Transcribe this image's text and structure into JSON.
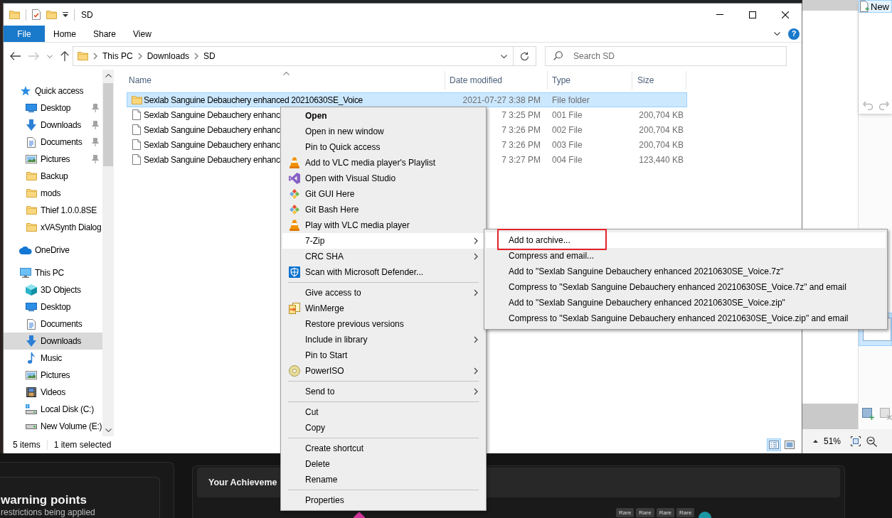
{
  "explorer": {
    "title": "SD",
    "ribbon": {
      "tabs": [
        {
          "label": "File",
          "kind": "menu"
        },
        {
          "label": "Home",
          "kind": "tab"
        },
        {
          "label": "Share",
          "kind": "tab"
        },
        {
          "label": "View",
          "kind": "tab"
        }
      ],
      "help": "?"
    },
    "history": {
      "back_disabled": false,
      "forward_disabled": true
    },
    "address": {
      "crumbs": [
        "This PC",
        "Downloads",
        "SD"
      ]
    },
    "search": {
      "placeholder": "Search SD"
    },
    "navigation": [
      {
        "label": "Quick access",
        "selected": false,
        "children": [
          {
            "label": "Desktop",
            "pinned": true,
            "selected": false
          },
          {
            "label": "Downloads",
            "pinned": true,
            "selected": false
          },
          {
            "label": "Documents",
            "pinned": true,
            "selected": false
          },
          {
            "label": "Pictures",
            "pinned": true,
            "selected": false
          },
          {
            "label": "Backup",
            "pinned": false,
            "selected": false
          },
          {
            "label": "mods",
            "pinned": false,
            "selected": false
          },
          {
            "label": "Thief 1.0.0.8SE",
            "pinned": false,
            "selected": false
          },
          {
            "label": "xVASynth Dialog",
            "pinned": false,
            "selected": false
          }
        ]
      },
      {
        "label": "OneDrive",
        "selected": false
      },
      {
        "label": "This PC",
        "selected": false,
        "children": [
          {
            "label": "3D Objects",
            "selected": false
          },
          {
            "label": "Desktop",
            "selected": false
          },
          {
            "label": "Documents",
            "selected": false
          },
          {
            "label": "Downloads",
            "selected": true
          },
          {
            "label": "Music",
            "selected": false
          },
          {
            "label": "Pictures",
            "selected": false
          },
          {
            "label": "Videos",
            "selected": false
          },
          {
            "label": "Local Disk (C:)",
            "selected": false
          },
          {
            "label": "New Volume (E:)",
            "selected": false
          }
        ]
      }
    ],
    "columns": [
      {
        "label": "Name",
        "sorted": true
      },
      {
        "label": "Date modified",
        "sorted": false
      },
      {
        "label": "Type",
        "sorted": false
      },
      {
        "label": "Size",
        "sorted": false
      }
    ],
    "files": [
      {
        "kind": "folder",
        "name": "Sexlab Sanguine Debauchery enhanced 20210630SE_Voice",
        "date": "2021-07-27 3:38 PM",
        "type": "File folder",
        "selected": true
      },
      {
        "kind": "file",
        "name": "Sexlab Sanguine Debauchery enhanc",
        "date": "7 3:25 PM",
        "type": "001 File",
        "size": "200,704 KB",
        "selected": false
      },
      {
        "kind": "file",
        "name": "Sexlab Sanguine Debauchery enhanc",
        "date": "7 3:26 PM",
        "type": "002 File",
        "size": "200,704 KB",
        "selected": false
      },
      {
        "kind": "file",
        "name": "Sexlab Sanguine Debauchery enhanc",
        "date": "7 3:26 PM",
        "type": "003 File",
        "size": "200,704 KB",
        "selected": false
      },
      {
        "kind": "file",
        "name": "Sexlab Sanguine Debauchery enhanc",
        "date": "7 3:27 PM",
        "type": "004 File",
        "size": "123,440 KB",
        "selected": false
      }
    ],
    "status": {
      "count": "5 items",
      "selection": "1 item selected"
    },
    "view_buttons": [
      {
        "selected": true
      },
      {
        "selected": false
      }
    ]
  },
  "context_menu": {
    "groups": [
      [
        {
          "label": "Open",
          "default": true,
          "submenu": false,
          "selected": false
        },
        {
          "label": "Open in new window",
          "default": false,
          "submenu": false,
          "selected": false
        },
        {
          "label": "Pin to Quick access",
          "default": false,
          "submenu": false,
          "selected": false
        },
        {
          "label": "Add to VLC media player's Playlist",
          "default": false,
          "submenu": false,
          "selected": false
        },
        {
          "label": "Open with Visual Studio",
          "default": false,
          "submenu": false,
          "selected": false
        },
        {
          "label": "Git GUI Here",
          "default": false,
          "submenu": false,
          "selected": false
        },
        {
          "label": "Git Bash Here",
          "default": false,
          "submenu": false,
          "selected": false
        },
        {
          "label": "Play with VLC media player",
          "default": false,
          "submenu": false,
          "selected": false
        },
        {
          "label": "7-Zip",
          "default": false,
          "submenu": true,
          "selected": true
        },
        {
          "label": "CRC SHA",
          "default": false,
          "submenu": true,
          "selected": false
        },
        {
          "label": "Scan with Microsoft Defender...",
          "default": false,
          "submenu": false,
          "selected": false
        }
      ],
      [
        {
          "label": "Give access to",
          "default": false,
          "submenu": true,
          "selected": false
        },
        {
          "label": "WinMerge",
          "default": false,
          "submenu": false,
          "selected": false
        },
        {
          "label": "Restore previous versions",
          "default": false,
          "submenu": false,
          "selected": false
        },
        {
          "label": "Include in library",
          "default": false,
          "submenu": true,
          "selected": false
        },
        {
          "label": "Pin to Start",
          "default": false,
          "submenu": false,
          "selected": false
        },
        {
          "label": "PowerISO",
          "default": false,
          "submenu": true,
          "selected": false
        }
      ],
      [
        {
          "label": "Send to",
          "default": false,
          "submenu": true,
          "selected": false
        }
      ],
      [
        {
          "label": "Cut",
          "default": false,
          "submenu": false,
          "selected": false
        },
        {
          "label": "Copy",
          "default": false,
          "submenu": false,
          "selected": false
        }
      ],
      [
        {
          "label": "Create shortcut",
          "default": false,
          "submenu": false,
          "selected": false
        },
        {
          "label": "Delete",
          "default": false,
          "submenu": false,
          "selected": false
        },
        {
          "label": "Rename",
          "default": false,
          "submenu": false,
          "selected": false
        }
      ],
      [
        {
          "label": "Properties",
          "default": false,
          "submenu": false,
          "selected": false
        }
      ]
    ],
    "submenu": {
      "items": [
        {
          "label": "Add to archive...",
          "selected": true,
          "marked": true
        },
        {
          "label": "Compress and email...",
          "selected": false,
          "marked": false
        },
        {
          "label": "Add to \"Sexlab Sanguine Debauchery enhanced 20210630SE_Voice.7z\"",
          "selected": false,
          "marked": false
        },
        {
          "label": "Compress to \"Sexlab Sanguine Debauchery enhanced 20210630SE_Voice.7z\" and email",
          "selected": false,
          "marked": false
        },
        {
          "label": "Add to \"Sexlab Sanguine Debauchery enhanced 20210630SE_Voice.zip\"",
          "selected": false,
          "marked": false
        },
        {
          "label": "Compress to \"Sexlab Sanguine Debauchery enhanced 20210630SE_Voice.zip\" and email",
          "selected": false,
          "marked": false
        }
      ]
    }
  },
  "side_app": {
    "new_item": "New",
    "zoom": "51%"
  },
  "web_page": {
    "card_title": "warning points",
    "card_text": "restrictions being applied",
    "section_title": "Your Achieveme",
    "tags": [
      "Rare",
      "Rare",
      "Rare",
      "Rare"
    ]
  }
}
